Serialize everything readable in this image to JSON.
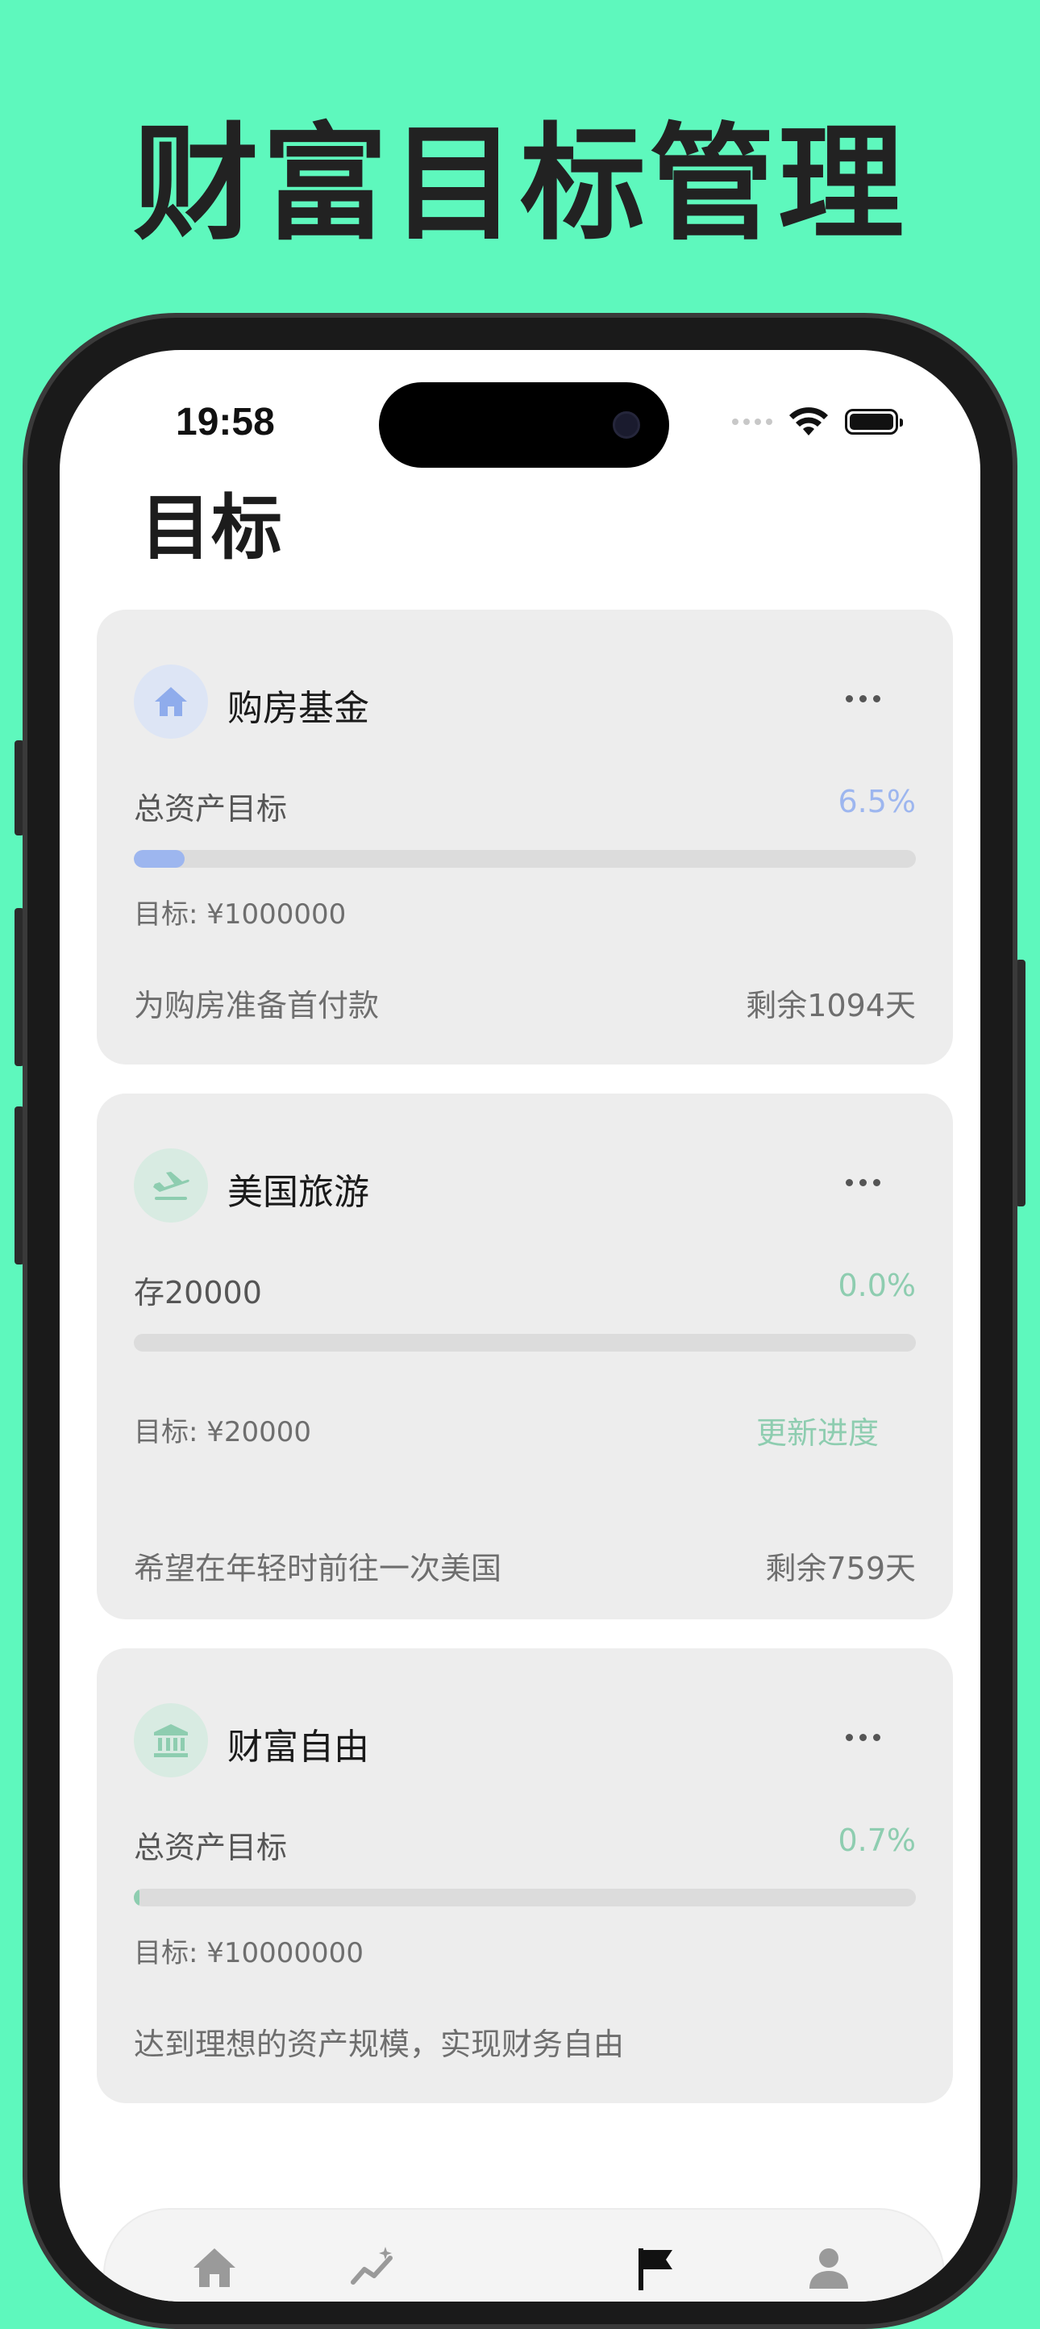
{
  "hero": {
    "title": "财富目标管理"
  },
  "status_bar": {
    "time": "19:58",
    "icons": [
      "cellular-icon",
      "wifi-icon",
      "battery-icon"
    ]
  },
  "page": {
    "title": "目标"
  },
  "colors": {
    "background": "#5ef8bd",
    "blue_accent": "#9db6ef",
    "green_accent": "#8ecdb0",
    "card_bg": "#ededed"
  },
  "goals": [
    {
      "icon": "house-icon",
      "name": "购房基金",
      "label": "总资产目标",
      "percent_text": "6.5%",
      "progress": 0.065,
      "target": "目标: ¥1000000",
      "description": "为购房准备首付款",
      "remaining": "剩余1094天"
    },
    {
      "icon": "airplane-icon",
      "name": "美国旅游",
      "label": "存20000",
      "percent_text": "0.0%",
      "progress": 0.0,
      "target": "目标: ¥20000",
      "update_label": "更新进度",
      "description": "希望在年轻时前往一次美国",
      "remaining": "剩余759天"
    },
    {
      "icon": "bank-icon",
      "name": "财富自由",
      "label": "总资产目标",
      "percent_text": "0.7%",
      "progress": 0.007,
      "target": "目标: ¥10000000",
      "description": "达到理想的资产规模，实现财务自由"
    }
  ],
  "tabbar": {
    "tabs": [
      "home-icon",
      "stats-icon",
      "flag-icon",
      "profile-icon"
    ],
    "active": "flag-icon"
  }
}
